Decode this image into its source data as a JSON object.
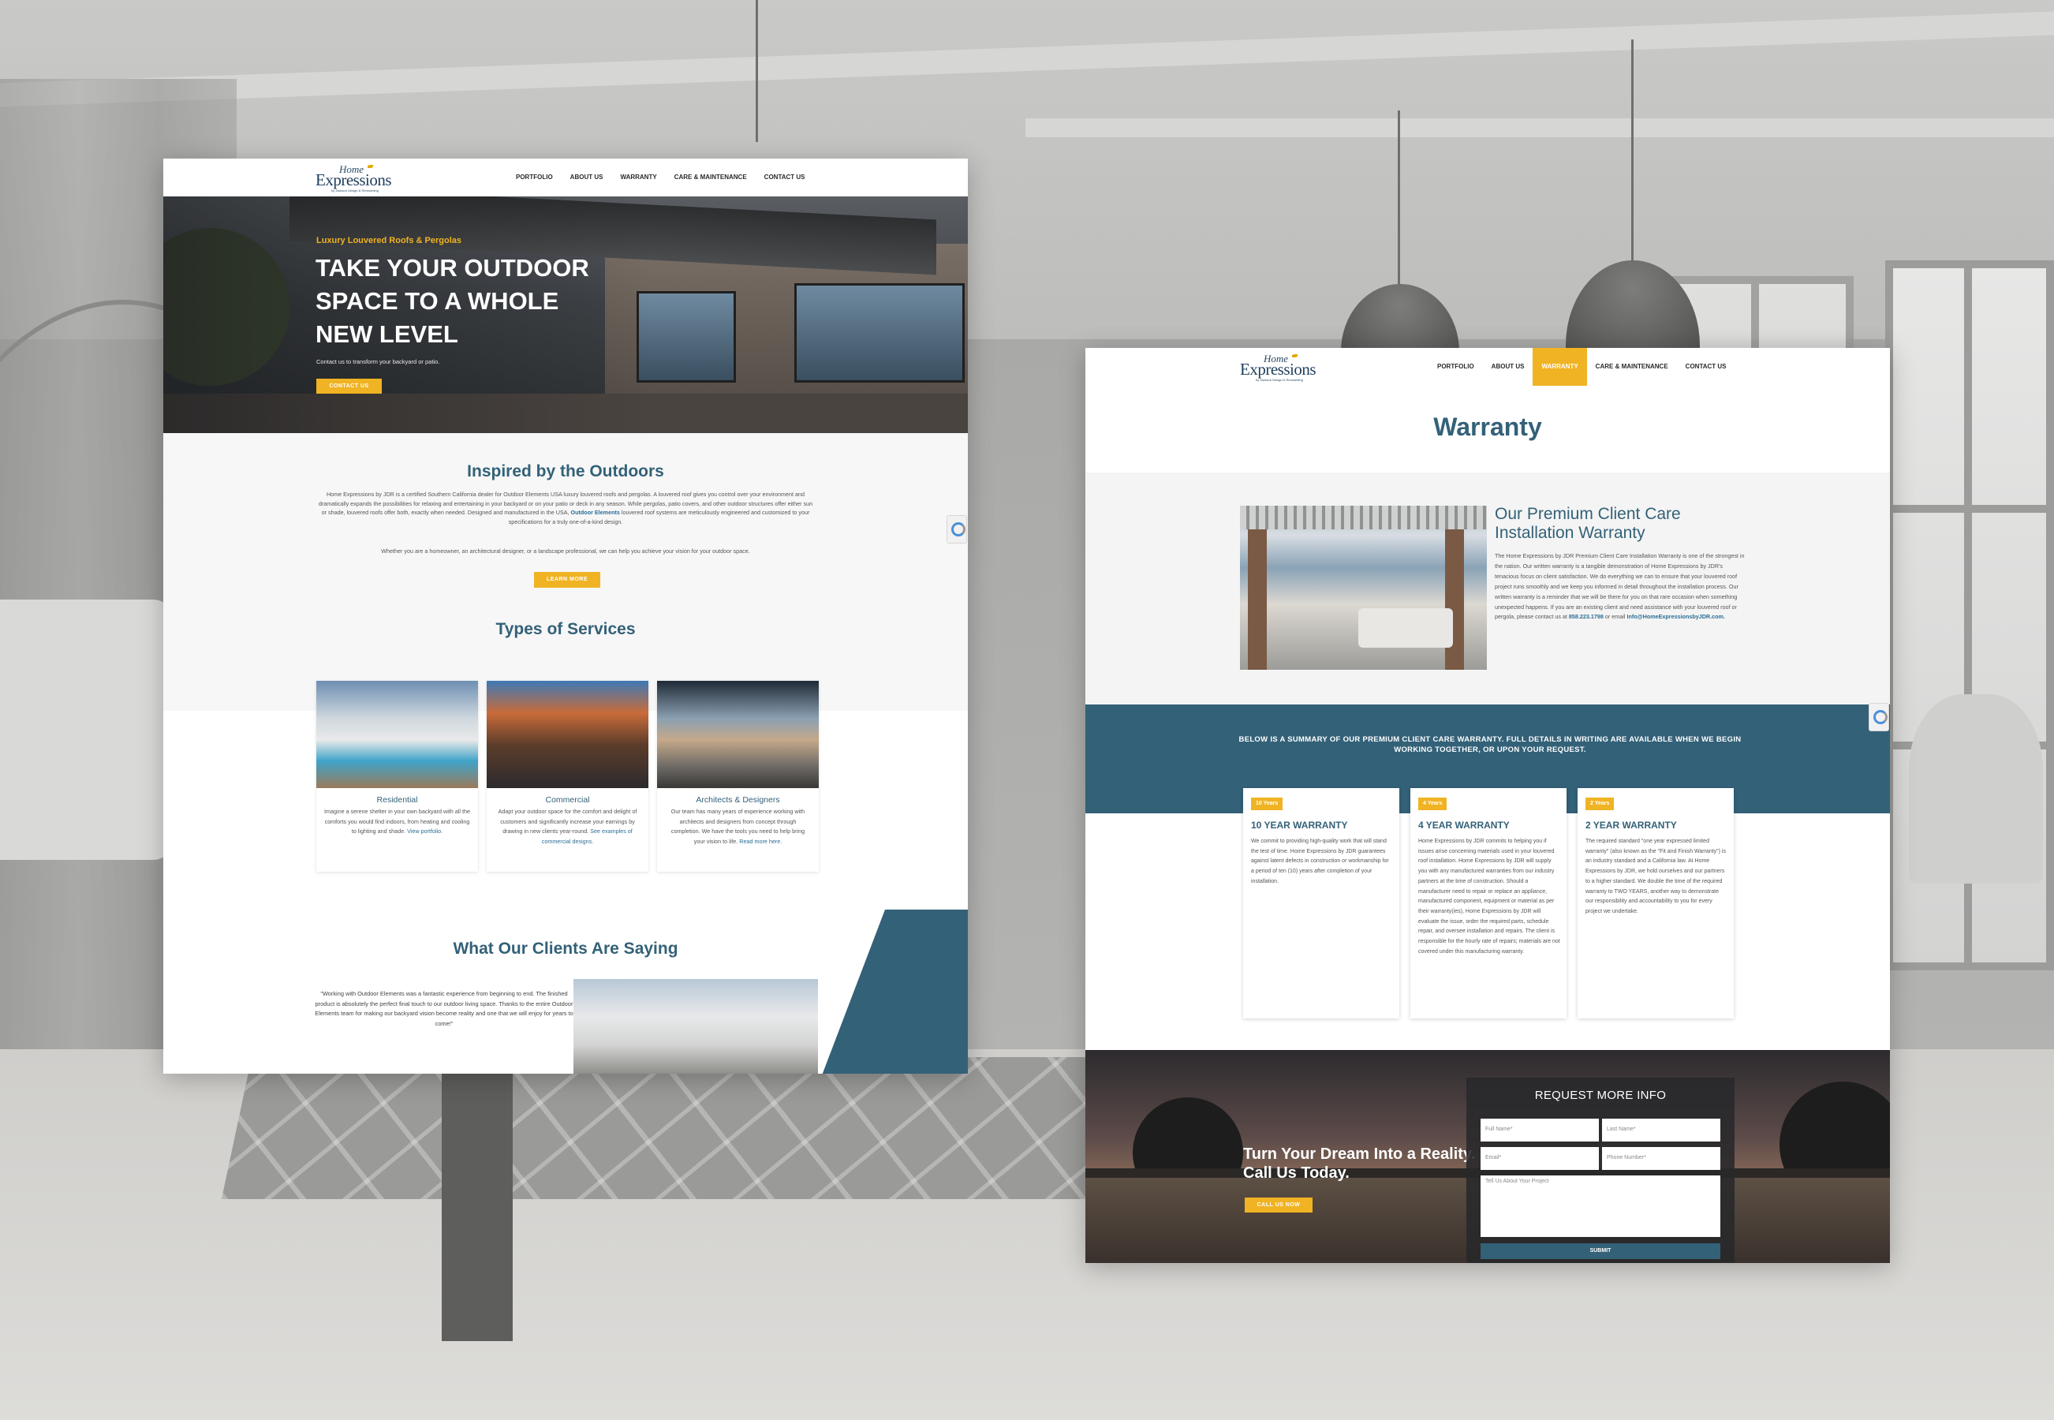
{
  "left_page": {
    "logo": {
      "script": "Home",
      "main": "Expressions",
      "tagline": "by Jackson Design & Remodeling"
    },
    "nav": [
      "PORTFOLIO",
      "ABOUT US",
      "WARRANTY",
      "CARE & MAINTENANCE",
      "CONTACT US"
    ],
    "hero": {
      "kicker": "Luxury Louvered Roofs & Pergolas",
      "title": "TAKE YOUR OUTDOOR SPACE TO A WHOLE NEW LEVEL",
      "subtitle": "Contact us to transform your backyard or patio.",
      "cta": "CONTACT US"
    },
    "intro": {
      "title": "Inspired by the Outdoors",
      "p1_a": "Home Expressions by JDR is a certified Southern California dealer for Outdoor Elements USA luxury louvered roofs and pergolas. A louvered roof gives you control over your environment and dramatically expands the possibilities for relaxing and entertaining in your backyard or on your patio or deck in any season. While pergolas, patio covers, and other outdoor structures offer either sun or shade, louvered roofs offer both, exactly when needed. Designed and manufactured in the USA,",
      "p1_link": "Outdoor Elements",
      "p1_b": "louvered roof systems are meticulously engineered and customized to your specifications for a truly one-of-a-kind design.",
      "p2": "Whether you are a homeowner, an architectural designer, or a landscape professional, we can help you achieve your vision for your outdoor space.",
      "cta": "LEARN MORE"
    },
    "services": {
      "title": "Types of Services",
      "items": [
        {
          "title": "Residential",
          "text": "Imagine a serene shelter in your own backyard with all the comforts you would find indoors, from heating and cooling to lighting and shade.",
          "link": "View portfolio."
        },
        {
          "title": "Commercial",
          "text": "Adapt your outdoor space for the comfort and delight of customers and significantly increase your earnings by drawing in new clients year-round.",
          "link": "See examples of commercial designs."
        },
        {
          "title": "Architects & Designers",
          "text": "Our team has many years of experience working with architects and designers from concept through completion. We have the tools you need to help bring your vision to life.",
          "link": "Read more here."
        }
      ]
    },
    "testimonials": {
      "title": "What Our Clients Are Saying",
      "quote": "\"Working with Outdoor Elements was a fantastic experience from beginning to end. The finished product is absolutely the perfect final touch to our outdoor living space. Thanks to the entire Outdoor Elements team for making our backyard vision become reality and one that we will enjoy for years to come!\""
    }
  },
  "right_page": {
    "logo": {
      "script": "Home",
      "main": "Expressions",
      "tagline": "by Jackson Design & Remodeling"
    },
    "nav": [
      "PORTFOLIO",
      "ABOUT US",
      "WARRANTY",
      "CARE & MAINTENANCE",
      "CONTACT US"
    ],
    "nav_active": "WARRANTY",
    "page_title": "Warranty",
    "premium": {
      "title": "Our Premium Client Care Installation Warranty",
      "text": "The Home Expressions by JDR Premium Client Care Installation Warranty is one of the strongest in the nation. Our written warranty is a tangible demonstration of Home Expressions by JDR's tenacious focus on client satisfaction. We do everything we can to ensure that your louvered roof project runs smoothly and we keep you informed in detail throughout the installation process. Our written warranty is a reminder that we will be there for you on that rare occasion when something unexpected happens. If you are an existing client and need assistance with your louvered roof or pergola, please contact us at",
      "phone": "858.223.1798",
      "or_email": "or email",
      "email": "Info@HomeExpressionsbyJDR.com."
    },
    "banner": "BELOW IS A SUMMARY OF OUR PREMIUM CLIENT CARE WARRANTY. FULL DETAILS IN WRITING ARE AVAILABLE WHEN WE BEGIN WORKING TOGETHER, OR UPON YOUR REQUEST.",
    "warranties": [
      {
        "badge": "10 Years",
        "title": "10 YEAR WARRANTY",
        "text": "We commit to providing high-quality work that will stand the test of time. Home Expressions by JDR guarantees against latent defects in construction or workmanship for a period of ten (10) years after completion of your installation."
      },
      {
        "badge": "4 Years",
        "title": "4 YEAR WARRANTY",
        "text": "Home Expressions by JDR commits to helping you if issues arise concerning materials used in your louvered roof installation. Home Expressions by JDR will supply you with any manufactured warranties from our industry partners at the time of construction. Should a manufacturer need to repair or replace an appliance, manufactured component, equipment or material as per their warranty(ies), Home Expressions by JDR will evaluate the issue, order the required parts, schedule repair, and oversee installation and repairs. The client is responsible for the hourly rate of repairs; materials are not covered under this manufacturing warranty."
      },
      {
        "badge": "2 Years",
        "title": "2 YEAR WARRANTY",
        "text": "The required standard \"one year expressed limited warranty\" (also known as the \"Fit and Finish Warranty\") is an industry standard and a California law. At Home Expressions by JDR, we hold ourselves and our partners to a higher standard. We double the time of the required warranty to TWO YEARS, another way to demonstrate our responsibility and accountability to you for every project we undertake."
      }
    ],
    "cta": {
      "title": "Turn Your Dream Into a Reality. Call Us Today.",
      "button": "CALL US NOW"
    },
    "form": {
      "heading": "REQUEST MORE INFO",
      "full_name": "Full Name*",
      "last_name": "Last Name*",
      "email": "Email*",
      "phone": "Phone Number*",
      "project": "Tell Us About Your Project",
      "submit": "SUBMIT"
    }
  }
}
